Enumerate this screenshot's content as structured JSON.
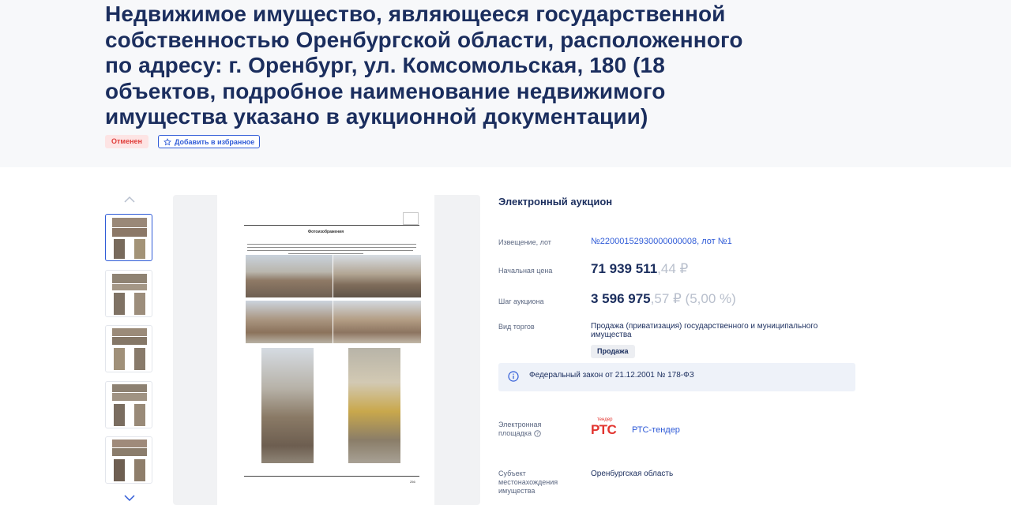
{
  "lot": {
    "title": "Недвижимое имущество, являющееся государственной собственностью Оренбургской области, расположенного по адресу: г. Оренбург, ул. Комсомольская, 180 (18 объектов, подробное наименование недвижимого имущества указано в аукционной документации)",
    "status": "Отменен",
    "favorite_label": "Добавить в избранное"
  },
  "auction": {
    "type": "Электронный аукцион",
    "notice_label": "Извещение, лот",
    "notice_value": "№22000152930000000008, лот №1",
    "start_price_label": "Начальная цена",
    "start_price_main": "71 939 511",
    "start_price_fraction": ",44 ₽",
    "step_label": "Шаг аукциона",
    "step_main": "3 596 975",
    "step_fraction": ",57 ₽ (5,00 %)",
    "trade_type_label": "Вид торгов",
    "trade_type_value": "Продажа (приватизация) государственного и муниципального имущества",
    "trade_tag": "Продажа",
    "law": "Федеральный закон от 21.12.2001 № 178-ФЗ",
    "platform_label_1": "Электронная",
    "platform_label_2": "площадка",
    "platform_name": "РТС-тендер",
    "platform_logo_top": "тендер",
    "platform_logo_main": "РТС",
    "subject_label_1": "Субъект",
    "subject_label_2": "местонахождения",
    "subject_label_3": "имущества",
    "subject_value": "Оренбургская область"
  },
  "gallery": {
    "doc_heading": "Фотоизображения",
    "doc_page": "256"
  },
  "colors": {
    "accent": "#2f5bd7",
    "title": "#1b2e5e",
    "status_bg": "#fde4e4",
    "status_text": "#e0403d"
  },
  "icons": {
    "favorite": "star-outline-icon",
    "up": "chevron-up-icon",
    "down": "chevron-down-icon",
    "info": "info-circle-icon",
    "help": "question-circle-icon"
  }
}
